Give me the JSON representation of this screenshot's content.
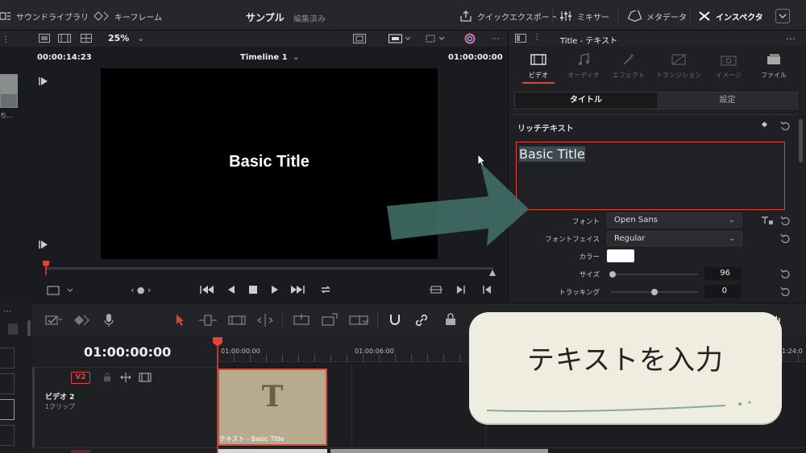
{
  "topbar": {
    "sound_library": "サウンドライブラリ",
    "keyframes": "キーフレーム",
    "project_name": "サンプル",
    "project_status": "編集済み",
    "quick_export": "クイックエクスポート",
    "mixer": "ミキサー",
    "metadata": "メタデータ",
    "inspector": "インスペクタ"
  },
  "viewer": {
    "zoom": "25%",
    "timecode_left": "00:00:14:23",
    "timeline_name": "Timeline 1",
    "timecode_right": "01:00:00:00",
    "title_text": "Basic Title"
  },
  "inspector": {
    "header_title": "Title - テキスト",
    "tabs": [
      {
        "label": "ビデオ",
        "active": true
      },
      {
        "label": "オーディオ",
        "active": false
      },
      {
        "label": "エフェクト",
        "active": false
      },
      {
        "label": "トランジション",
        "active": false
      },
      {
        "label": "イメージ",
        "active": false
      },
      {
        "label": "ファイル",
        "active": false
      }
    ],
    "subtab_title": "タイトル",
    "subtab_settings": "設定",
    "section_rich_text": "リッチテキスト",
    "text_value": "Basic Title",
    "font_label": "フォント",
    "font_value": "Open Sans",
    "face_label": "フォントフェイス",
    "face_value": "Regular",
    "color_label": "カラー",
    "size_label": "サイズ",
    "size_value": "96",
    "tracking_label": "トラッキング",
    "tracking_value": "0"
  },
  "timeline": {
    "timecode": "01:00:00:00",
    "ruler": [
      "01:00:00:00",
      "01:00:06:00",
      "1:24:0"
    ],
    "track_tag": "V2",
    "track_name": "ビデオ 2",
    "track_clips": "1クリップ",
    "clip_label": "テキスト - Basic Title",
    "clip_glyph": "T"
  },
  "callout": {
    "text": "テキストを入力"
  },
  "colors": {
    "accent_red": "#e0453a",
    "arrow": "#3e6b63",
    "callout_bg": "#efece0"
  }
}
